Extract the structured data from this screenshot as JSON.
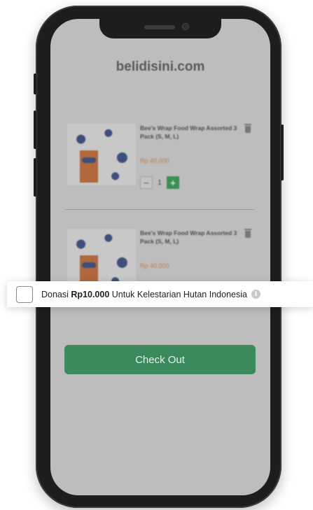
{
  "site": {
    "title": "belidisini.com"
  },
  "cart": {
    "items": [
      {
        "name": "Bee's Wrap Food Wrap Assorted 3 Pack (S, M, L)",
        "price": "Rp 40.000",
        "quantity": "1"
      },
      {
        "name": "Bee's Wrap Food Wrap Assorted 3 Pack (S, M, L)",
        "price": "Rp 40.000",
        "quantity": ""
      }
    ],
    "minus_symbol": "−",
    "plus_symbol": "+"
  },
  "donation": {
    "prefix": "Donasi ",
    "amount": "Rp10.000",
    "suffix": " Untuk Kelestarian Hutan Indonesia",
    "checked": false,
    "info_symbol": "i"
  },
  "checkout": {
    "label": "Check Out"
  },
  "colors": {
    "accent_green": "#3a8a5c",
    "price_orange": "#c77a44",
    "overlay_grey": "#bdbdbd",
    "phone_frame": "#1d1d1f"
  },
  "icons": [
    "trash-icon",
    "info-icon",
    "minus-icon",
    "plus-icon"
  ]
}
